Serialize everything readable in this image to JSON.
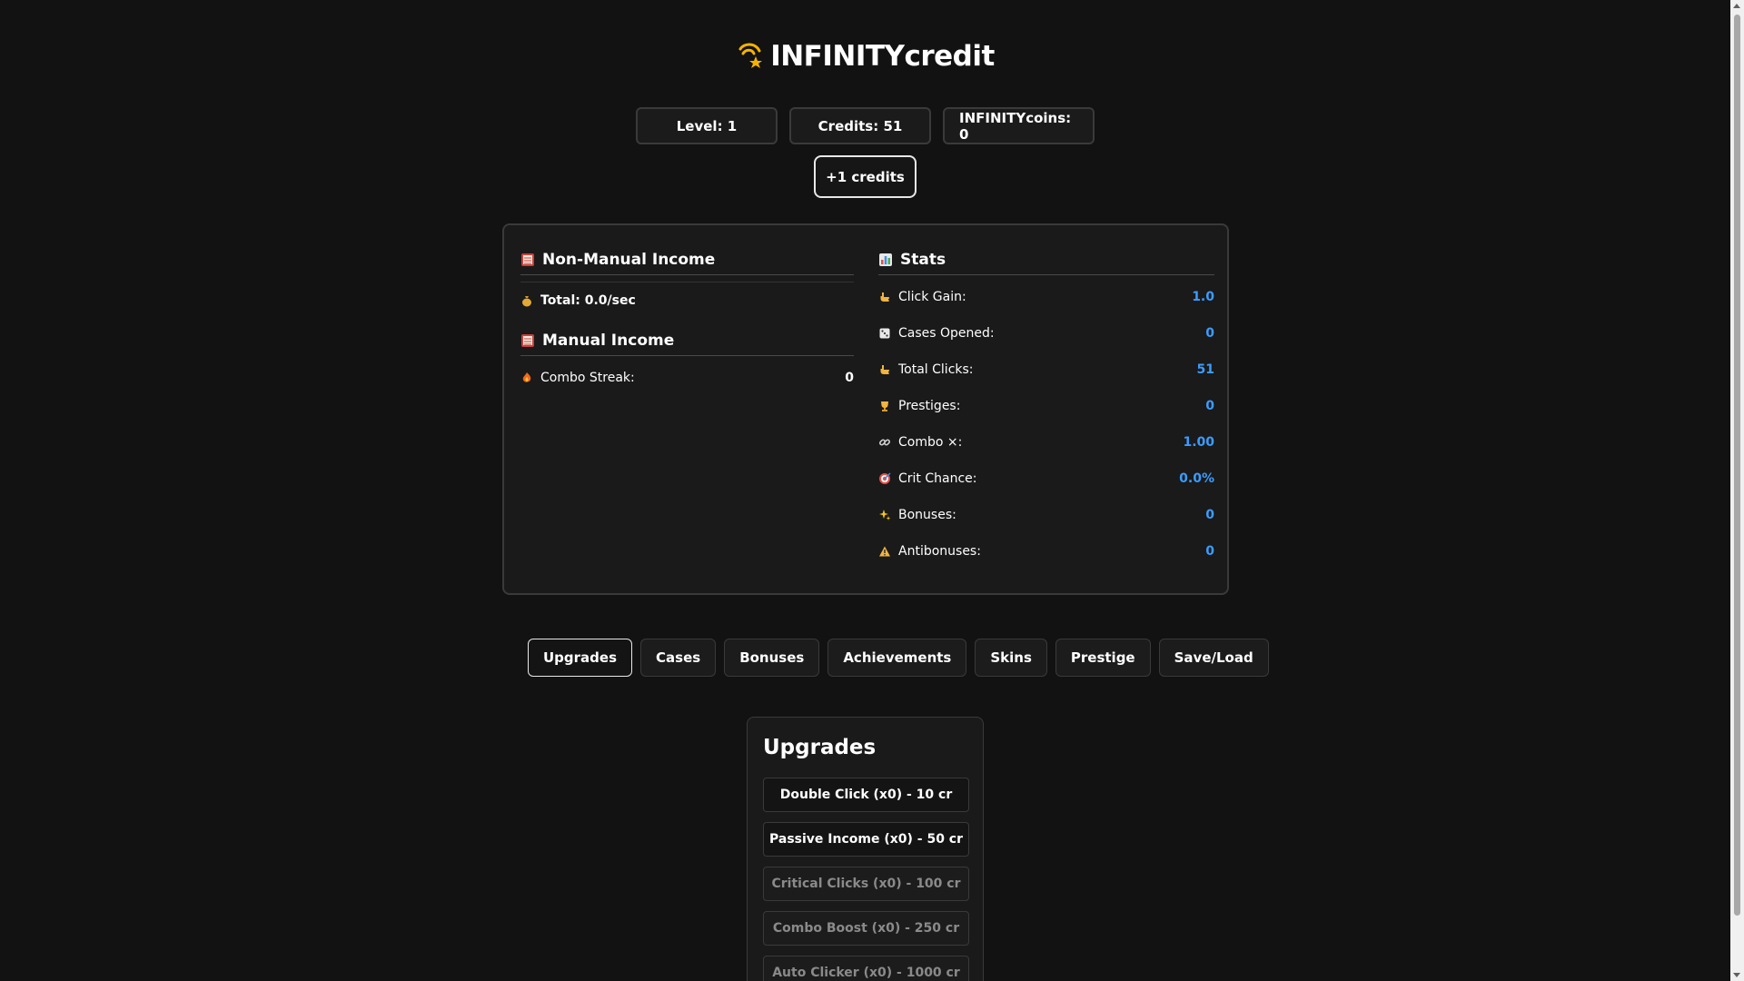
{
  "app": {
    "title": "INFINITYcredit",
    "logo_icon": "shooting-star-icon"
  },
  "header": {
    "level": "Level: 1",
    "credits": "Credits: 51",
    "coins": "INFINITYcoins: 0",
    "click_button": "+1 credits"
  },
  "non_manual": {
    "heading": "Non-Manual Income",
    "total": "Total: 0.0/sec"
  },
  "manual": {
    "heading": "Manual Income",
    "combo_label": "Combo Streak:",
    "combo_value": "0"
  },
  "stats": {
    "heading": "Stats",
    "items": [
      {
        "icon": "pointing-hand-icon",
        "label": "Click Gain:",
        "value": "1.0"
      },
      {
        "icon": "dice-icon",
        "label": "Cases Opened:",
        "value": "0"
      },
      {
        "icon": "pointing-hand-icon",
        "label": "Total Clicks:",
        "value": "51"
      },
      {
        "icon": "trophy-icon",
        "label": "Prestiges:",
        "value": "0"
      },
      {
        "icon": "link-icon",
        "label": "Combo ×:",
        "value": "1.00"
      },
      {
        "icon": "target-icon",
        "label": "Crit Chance:",
        "value": "0.0%"
      },
      {
        "icon": "sparkles-icon",
        "label": "Bonuses:",
        "value": "0"
      },
      {
        "icon": "warning-icon",
        "label": "Antibonuses:",
        "value": "0"
      }
    ]
  },
  "tabs": [
    {
      "label": "Upgrades",
      "active": true
    },
    {
      "label": "Cases"
    },
    {
      "label": "Bonuses"
    },
    {
      "label": "Achievements"
    },
    {
      "label": "Skins"
    },
    {
      "label": "Prestige"
    },
    {
      "label": "Save/Load"
    }
  ],
  "upgrades": {
    "heading": "Upgrades",
    "items": [
      {
        "label": "Double Click (x0) - 10 cr",
        "enabled": true
      },
      {
        "label": "Passive Income (x0) - 50 cr",
        "enabled": true
      },
      {
        "label": "Critical Clicks (x0) - 100 cr",
        "enabled": false
      },
      {
        "label": "Combo Boost (x0) - 250 cr",
        "enabled": false
      },
      {
        "label": "Auto Clicker (x0) - 1000 cr",
        "enabled": false
      }
    ]
  },
  "colors": {
    "background": "#121212",
    "accent_value": "#3b9cff"
  }
}
